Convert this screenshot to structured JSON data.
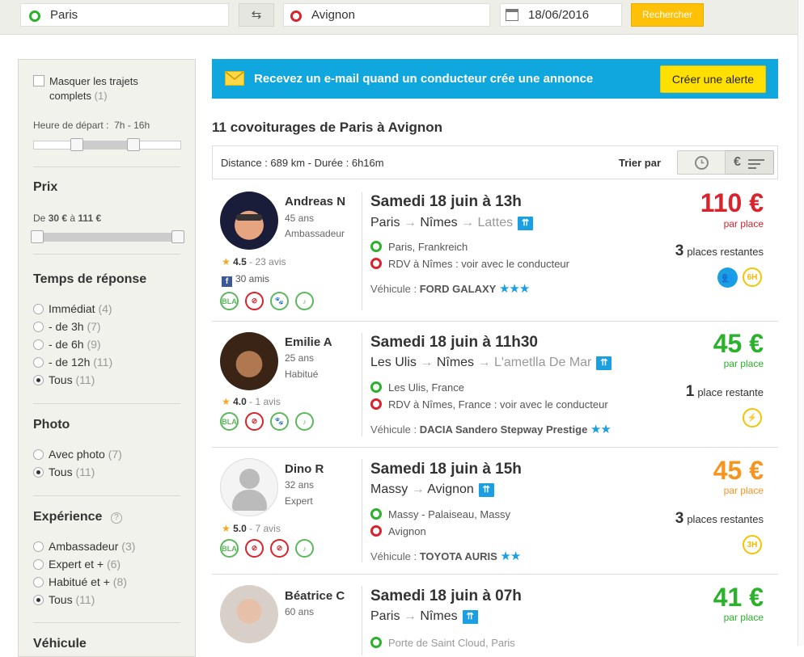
{
  "search": {
    "from": "Paris",
    "to": "Avignon",
    "date": "18/06/2016",
    "button": "Rechercher"
  },
  "sidebar": {
    "hide_full": {
      "label": "Masquer les trajets complets",
      "count": "(1)"
    },
    "departure": {
      "label": "Heure de départ :",
      "range": "7h - 16h",
      "low_fraction": 0.29,
      "high_fraction": 0.67
    },
    "price": {
      "title": "Prix",
      "from_label": "De",
      "min": "30 €",
      "to_label": "à",
      "max": "111 €"
    },
    "response": {
      "title": "Temps de réponse",
      "options": [
        {
          "label": "Immédiat",
          "count": "(4)"
        },
        {
          "label": "- de 3h",
          "count": "(7)"
        },
        {
          "label": "- de 6h",
          "count": "(9)"
        },
        {
          "label": "- de 12h",
          "count": "(11)"
        },
        {
          "label": "Tous",
          "count": "(11)"
        }
      ],
      "selected": "Tous"
    },
    "photo": {
      "title": "Photo",
      "options": [
        {
          "label": "Avec photo",
          "count": "(7)"
        },
        {
          "label": "Tous",
          "count": "(11)"
        }
      ],
      "selected": "Tous"
    },
    "experience": {
      "title": "Expérience",
      "help": "?",
      "options": [
        {
          "label": "Ambassadeur",
          "count": "(3)"
        },
        {
          "label": "Expert et +",
          "count": "(6)"
        },
        {
          "label": "Habitué et +",
          "count": "(8)"
        },
        {
          "label": "Tous",
          "count": "(11)"
        }
      ],
      "selected": "Tous"
    },
    "cut_title": "Véhicule"
  },
  "alert": {
    "text": "Recevez un e-mail quand un conducteur crée une annonce",
    "button": "Créer une alerte"
  },
  "results": {
    "heading": "11 covoiturages de Paris à Avignon",
    "distance": "Distance : 689 km - Durée : 6h16m",
    "sort_label": "Trier par",
    "sort_price_symbol": "€"
  },
  "rides": [
    {
      "driver": "Andreas N",
      "age": "45 ans",
      "level": "Ambassadeur",
      "rating": "4.5",
      "reviews": "- 23 avis",
      "friends": "30 amis",
      "date": "Samedi 18 juin à 13h",
      "route": [
        "Paris",
        "Nîmes",
        "Lattes"
      ],
      "pickup": "Paris, Frankreich",
      "dropoff": "RDV à Nîmes : voir avec le conducteur",
      "vehicle_label": "Véhicule :",
      "vehicle": "FORD GALAXY",
      "vehicle_stars": "★★★",
      "price": "110 €",
      "price_color": "#d9232d",
      "per_place": "par place",
      "seats": "3",
      "seats_label": "places restantes",
      "badge": "6H"
    },
    {
      "driver": "Emilie A",
      "age": "25 ans",
      "level": "Habitué",
      "rating": "4.0",
      "reviews": "- 1 avis",
      "date": "Samedi 18 juin à 11h30",
      "route": [
        "Les Ulis",
        "Nîmes",
        "L'ametlla De Mar"
      ],
      "pickup": "Les Ulis, France",
      "dropoff": "RDV à Nîmes, France : voir avec le conducteur",
      "vehicle_label": "Véhicule :",
      "vehicle": "DACIA Sandero Stepway Prestige",
      "vehicle_stars": "★★",
      "price": "45 €",
      "price_color": "#2bb12b",
      "per_place": "par place",
      "seats": "1",
      "seats_label": "place restante",
      "badge": "⚡"
    },
    {
      "driver": "Dino R",
      "age": "32 ans",
      "level": "Expert",
      "rating": "5.0",
      "reviews": "- 7 avis",
      "date": "Samedi 18 juin à 15h",
      "route": [
        "Massy",
        "Avignon"
      ],
      "pickup": "Massy - Palaiseau, Massy",
      "dropoff": "Avignon",
      "vehicle_label": "Véhicule :",
      "vehicle": "TOYOTA AURIS",
      "vehicle_stars": "★★",
      "price": "45 €",
      "price_color": "#f7941d",
      "per_place": "par place",
      "seats": "3",
      "seats_label": "places restantes",
      "badge": "3H"
    },
    {
      "driver": "Béatrice C",
      "age": "60 ans",
      "date": "Samedi 18 juin à 07h",
      "route": [
        "Paris",
        "Nîmes"
      ],
      "pickup": "Porte de Saint Cloud, Paris",
      "price": "41 €",
      "price_color": "#2bb12b",
      "per_place": "par place"
    }
  ],
  "icons": {
    "green_ring": "#2bb12b",
    "red_ring": "#d9232d",
    "accent_blue": "#10a6de",
    "accent_yellow": "#ffc107"
  }
}
